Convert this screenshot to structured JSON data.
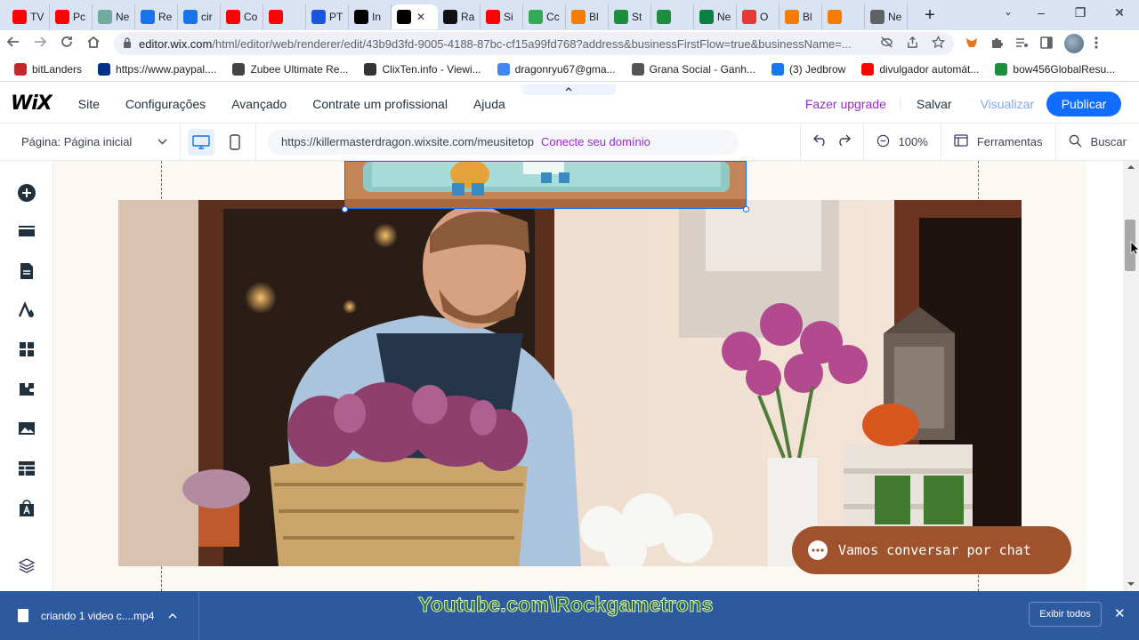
{
  "browser": {
    "tabs": [
      {
        "label": "TV",
        "color": "#ff0000"
      },
      {
        "label": "Pc",
        "color": "#ff0000"
      },
      {
        "label": "Ne",
        "color": "#74aa9c"
      },
      {
        "label": "Re",
        "color": "#1a73e8"
      },
      {
        "label": "cir",
        "color": "#1a73e8"
      },
      {
        "label": "Co",
        "color": "#ff0000"
      },
      {
        "label": "",
        "color": "#ff0000"
      },
      {
        "label": "PT",
        "color": "#1a56db"
      },
      {
        "label": "In",
        "color": "#000000"
      },
      {
        "label": "",
        "color": "#000000",
        "active": true
      },
      {
        "label": "Ra",
        "color": "#111111"
      },
      {
        "label": "Si",
        "color": "#ff0000"
      },
      {
        "label": "Cc",
        "color": "#34a853"
      },
      {
        "label": "Bl",
        "color": "#f57c00"
      },
      {
        "label": "St",
        "color": "#1e8e3e"
      },
      {
        "label": "",
        "color": "#1e8e3e"
      },
      {
        "label": "Ne",
        "color": "#0b8043"
      },
      {
        "label": "O",
        "color": "#e53935"
      },
      {
        "label": "Bl",
        "color": "#f57c00"
      },
      {
        "label": "",
        "color": "#f57c00"
      },
      {
        "label": "Ne",
        "color": "#5f6368"
      }
    ],
    "new_tab": "+",
    "window_controls": {
      "minimize": "–",
      "restore": "❐",
      "close": "✕"
    },
    "tab_search": "⌄",
    "address": {
      "host": "editor.wix.com",
      "path": "/html/editor/web/renderer/edit/43b9d3fd-9005-4188-87bc-cf15a99fd768?address&businessFirstFlow=true&businessName=..."
    },
    "bookmarks": [
      {
        "label": "bitLanders",
        "color": "#c62828"
      },
      {
        "label": "https://www.paypal....",
        "color": "#003087"
      },
      {
        "label": "Zubee Ultimate Re...",
        "color": "#444444"
      },
      {
        "label": "ClixTen.info - Viewi...",
        "color": "#333333"
      },
      {
        "label": "dragonryu67@gma...",
        "color": "#4285f4"
      },
      {
        "label": "Grana Social - Ganh...",
        "color": "#555555"
      },
      {
        "label": "(3) Jedbrow",
        "color": "#1877f2"
      },
      {
        "label": "divulgador automát...",
        "color": "#ff0000"
      },
      {
        "label": "bow456GlobalResu...",
        "color": "#1e8e3e"
      }
    ],
    "bookmarks_more": "»"
  },
  "wix": {
    "logo": "WiX",
    "menu": [
      "Site",
      "Configurações",
      "Avançado",
      "Contrate um profissional",
      "Ajuda"
    ],
    "upgrade": "Fazer upgrade",
    "save": "Salvar",
    "preview": "Visualizar",
    "publish": "Publicar",
    "page_label": "Página: Página inicial",
    "site_url": "https://killermasterdragon.wixsite.com/meusitetop",
    "connect_domain": "Conecte seu domínio",
    "zoom": "100%",
    "tools": "Ferramentas",
    "search": "Buscar"
  },
  "canvas": {
    "chat_button": "Vamos conversar por chat"
  },
  "downloads": {
    "file_name": "criando 1 video c....mp4",
    "show_all": "Exibir todos",
    "close": "✕"
  },
  "watermark": "Youtube.com\\Rockgametrons"
}
